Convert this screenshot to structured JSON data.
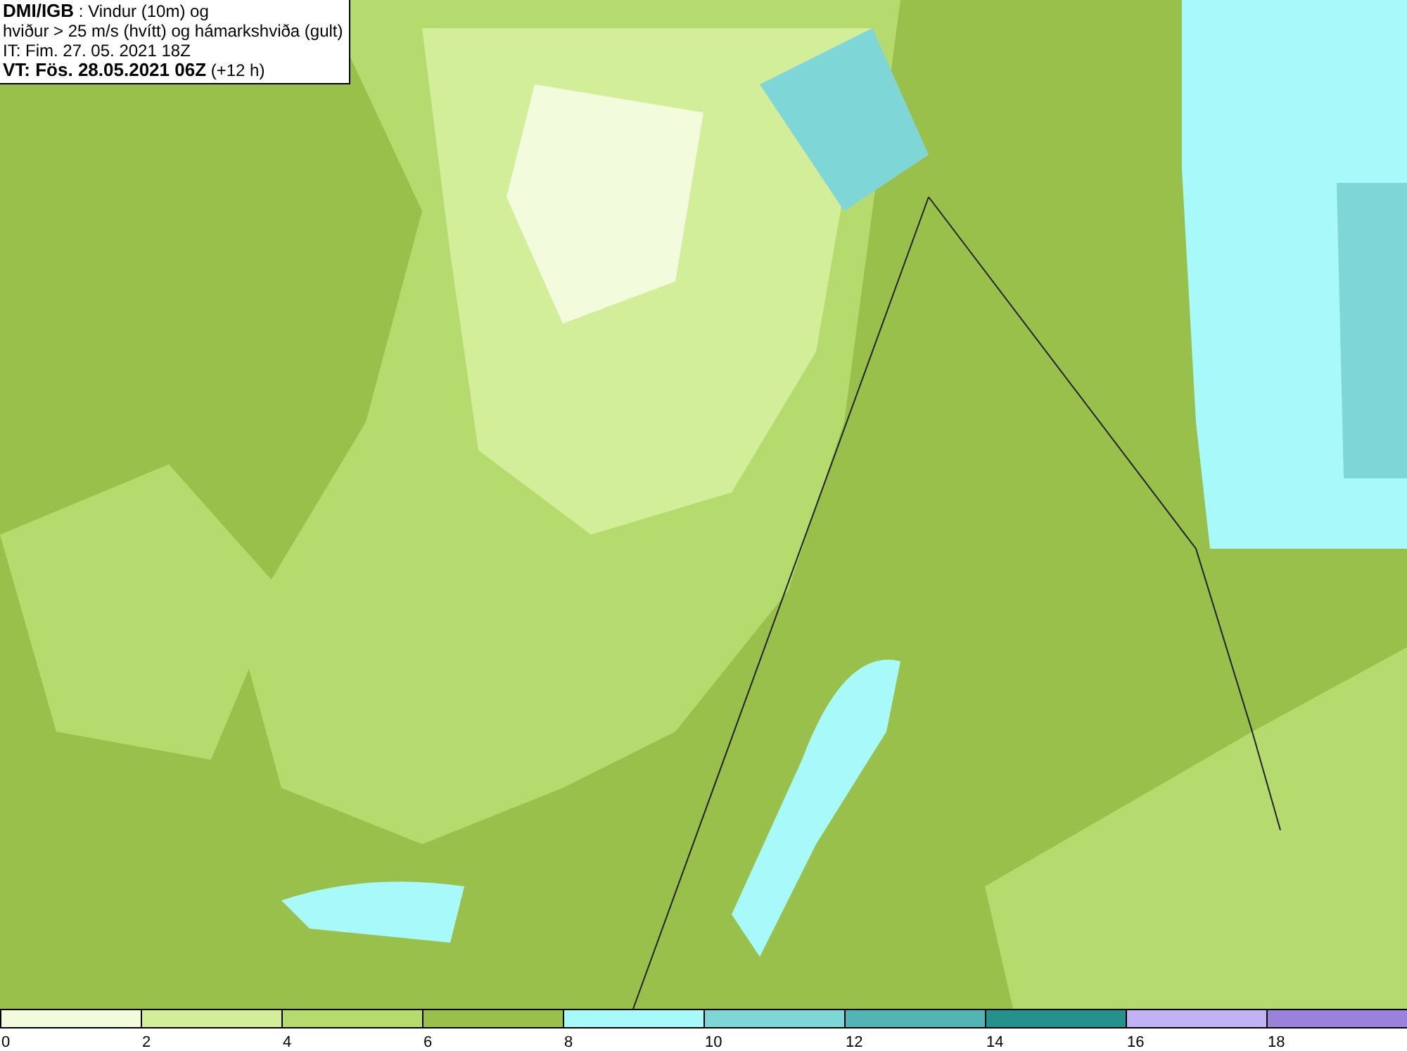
{
  "info_box": {
    "lines": [
      "**DMI/IGB** : Vindur (10m) og",
      "hviður > 25 m/s (hvítt) og hámarkshviða (gult)",
      "IT: Fim. 27. 05. 2021 18Z",
      "**VT: Fös. 28.05.2021 06Z** (+12 h)"
    ]
  },
  "legend": {
    "bins": [
      {
        "color": "#f2fbdc"
      },
      {
        "color": "#d3ee98"
      },
      {
        "color": "#b5da6e"
      },
      {
        "color": "#98c04a"
      },
      {
        "color": "#a8fafa"
      },
      {
        "color": "#7fd6d6"
      },
      {
        "color": "#52b4b4"
      },
      {
        "color": "#24918c"
      },
      {
        "color": "#c1b2f5"
      },
      {
        "color": "#9a82dc"
      }
    ],
    "ticks": [
      "0",
      "2",
      "4",
      "6",
      "8",
      "10",
      "12",
      "14",
      "16",
      "18"
    ]
  }
}
